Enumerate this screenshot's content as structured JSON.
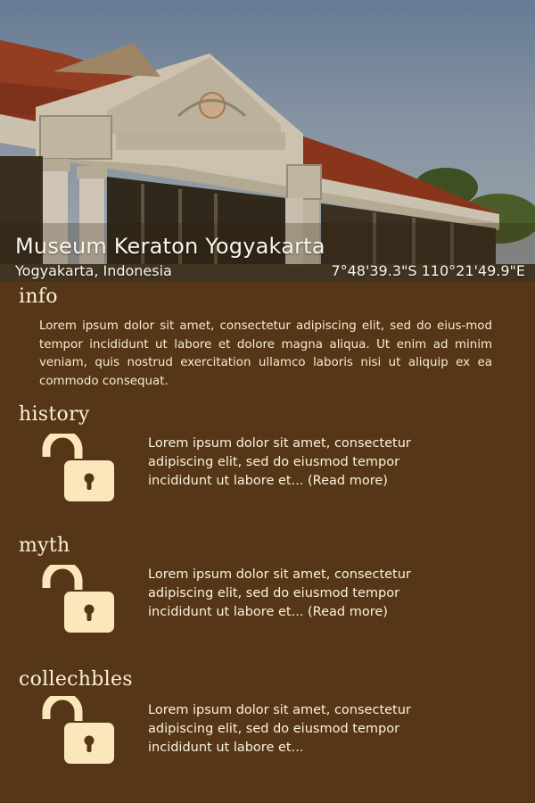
{
  "header": {
    "title": "Museum Keraton Yogyakarta",
    "location": "Yogyakarta, Indonesia",
    "coordinates": "7°48'39.3\"S 110°21'49.9\"E"
  },
  "info": {
    "title": "info",
    "text": "Lorem ipsum dolor sit amet, consectetur adipiscing elit, sed do eius-mod tempor incididunt ut labore et dolore magna aliqua. Ut enim ad minim veniam, quis nostrud exercitation ullamco laboris nisi ut aliquip ex ea commodo consequat."
  },
  "sections": [
    {
      "title": "history",
      "text": "Lorem ipsum dolor sit amet, consectetur adipiscing elit, sed do eiusmod tempor incididunt ut labore et... (Read more)",
      "icon": "unlocked-padlock-icon"
    },
    {
      "title": "myth",
      "text": "Lorem ipsum dolor sit amet, consectetur adipiscing elit, sed do eiusmod tempor incididunt ut labore et... (Read more)",
      "icon": "unlocked-padlock-icon"
    },
    {
      "title": "collechbles",
      "text": "Lorem ipsum dolor sit amet, consectetur adipiscing elit, sed do eiusmod tempor incididunt ut labore et...",
      "icon": "unlocked-padlock-icon"
    }
  ],
  "colors": {
    "background": "#553616",
    "lock": "#fbe7bb",
    "text": "#f5ecd6"
  }
}
